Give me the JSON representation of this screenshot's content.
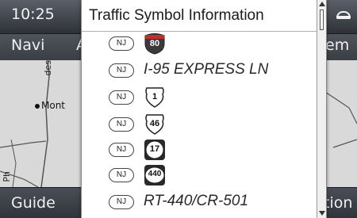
{
  "status": {
    "time": "10:25"
  },
  "tabs": {
    "navi": "Navi",
    "cut_label": "A",
    "right_cut": "em"
  },
  "map": {
    "city": "Mont",
    "road_label_1": "des",
    "road_label_2": "Ph"
  },
  "bottom": {
    "left": "Guide",
    "right": "tion"
  },
  "panel": {
    "title": "Traffic Symbol Information",
    "rows": [
      {
        "state": "NJ",
        "symbol": "interstate-shield",
        "text": "80"
      },
      {
        "state": "NJ",
        "symbol": "text",
        "text": "I-95 EXPRESS LN"
      },
      {
        "state": "NJ",
        "symbol": "us-route-shield",
        "text": "1"
      },
      {
        "state": "NJ",
        "symbol": "us-route-shield",
        "text": "46"
      },
      {
        "state": "NJ",
        "symbol": "circle-shield",
        "text": "17"
      },
      {
        "state": "NJ",
        "symbol": "county-shield",
        "text": "440"
      },
      {
        "state": "NJ",
        "symbol": "text",
        "text": "RT-440/CR-501"
      }
    ]
  },
  "colors": {
    "panel_bg": "#ffffff",
    "bar_bg": "#3a3e45",
    "map_bg": "#d9d9d9"
  }
}
